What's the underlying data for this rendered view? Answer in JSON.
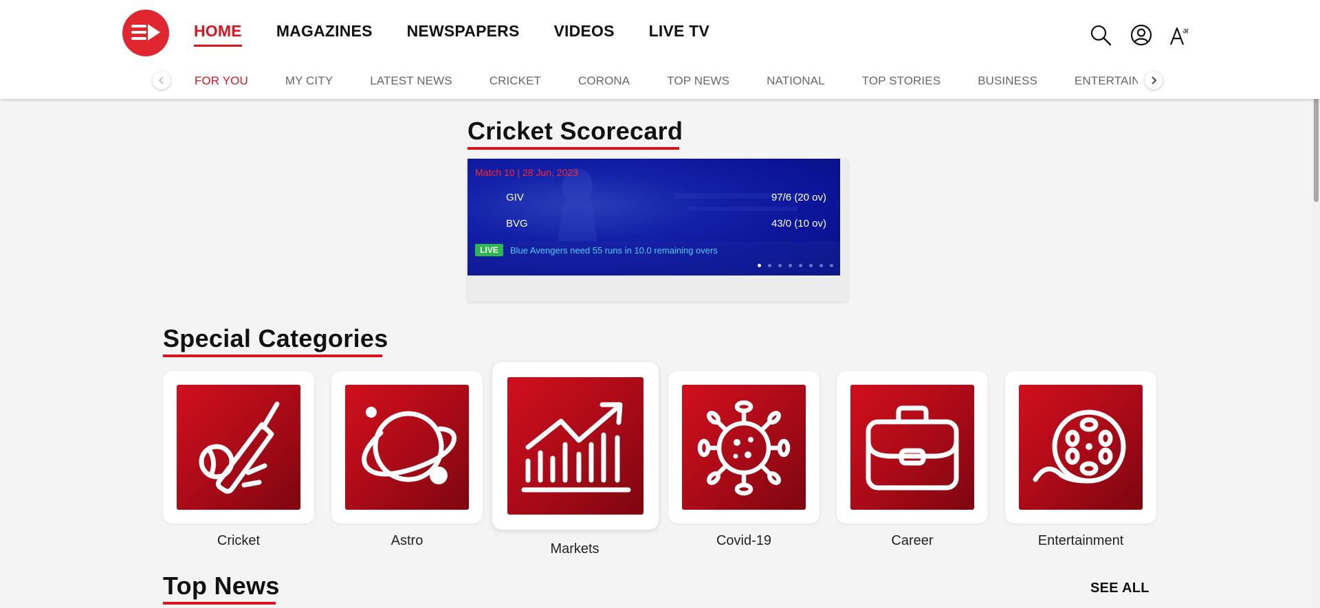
{
  "brand": {
    "accent": "#d8151f",
    "logo_color": "#e0262f"
  },
  "header": {
    "main_nav": [
      {
        "label": "HOME",
        "active": true
      },
      {
        "label": "MAGAZINES",
        "active": false
      },
      {
        "label": "NEWSPAPERS",
        "active": false
      },
      {
        "label": "VIDEOS",
        "active": false
      },
      {
        "label": "LIVE TV",
        "active": false
      }
    ],
    "icons": [
      "search-icon",
      "user-account-icon",
      "font-language-icon"
    ],
    "font_icon_text": "अ"
  },
  "sub_nav": {
    "items": [
      {
        "label": "FOR YOU",
        "active": true
      },
      {
        "label": "MY CITY"
      },
      {
        "label": "LATEST NEWS"
      },
      {
        "label": "CRICKET"
      },
      {
        "label": "CORONA"
      },
      {
        "label": "TOP NEWS"
      },
      {
        "label": "NATIONAL"
      },
      {
        "label": "TOP STORIES"
      },
      {
        "label": "BUSINESS"
      },
      {
        "label": "ENTERTAINMENT"
      }
    ]
  },
  "scorecard": {
    "title": "Cricket Scorecard",
    "match_info": "Match 10 | 28 Jun, 2023",
    "teams": [
      {
        "name": "GIV",
        "score": "97/6 (20 ov)"
      },
      {
        "name": "BVG",
        "score": "43/0 (10 ov)"
      }
    ],
    "live_label": "LIVE",
    "status": "Blue Avengers need 55 runs in 10.0 remaining overs",
    "slide_count": 8,
    "active_slide": 0
  },
  "special_categories": {
    "title": "Special Categories",
    "items": [
      {
        "label": "Cricket",
        "icon": "cricket-bat-ball-icon"
      },
      {
        "label": "Astro",
        "icon": "planet-icon"
      },
      {
        "label": "Markets",
        "icon": "market-chart-icon",
        "highlighted": true
      },
      {
        "label": "Covid-19",
        "icon": "virus-icon"
      },
      {
        "label": "Career",
        "icon": "briefcase-icon"
      },
      {
        "label": "Entertainment",
        "icon": "film-reel-icon"
      }
    ]
  },
  "top_news": {
    "title": "Top News",
    "see_all_label": "SEE ALL"
  }
}
